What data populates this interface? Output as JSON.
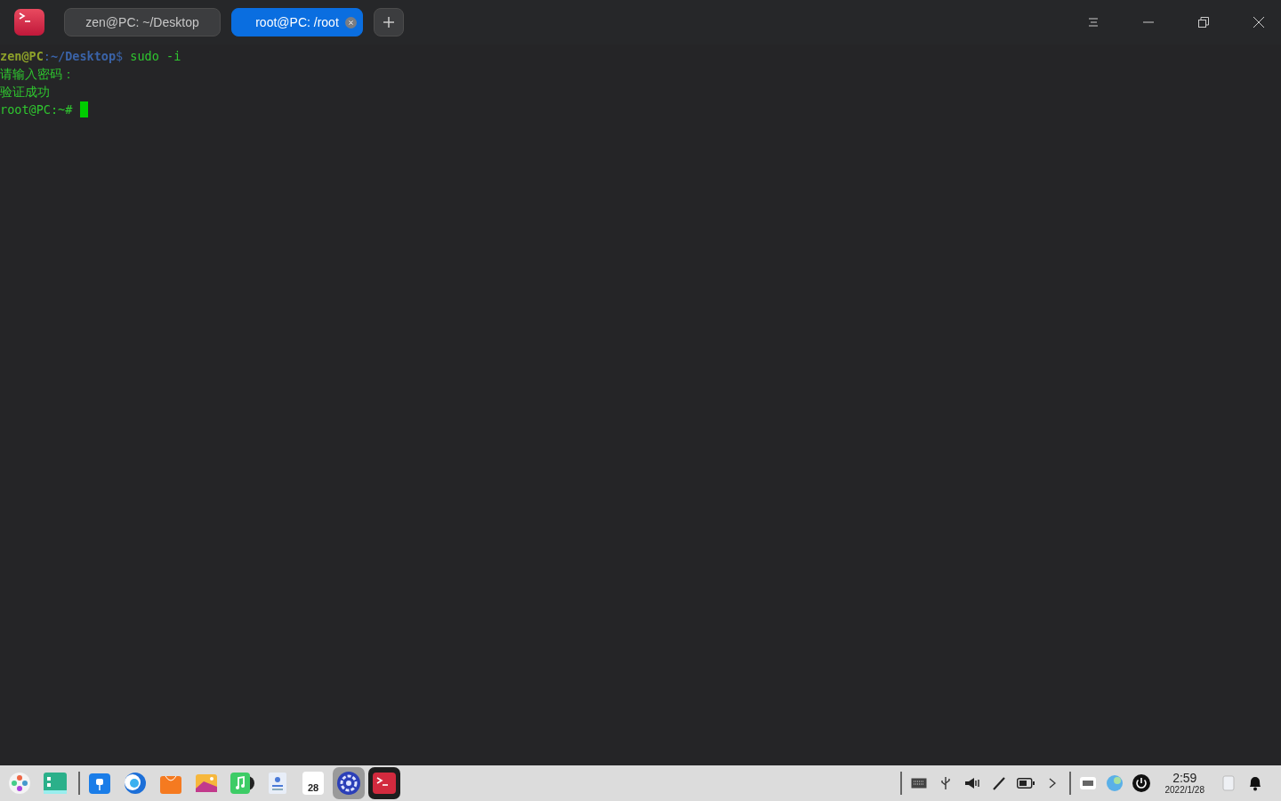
{
  "window": {
    "tabs": [
      {
        "label": "zen@PC: ~/Desktop",
        "selected": false
      },
      {
        "label": "root@PC: /root",
        "selected": true
      }
    ]
  },
  "terminal": {
    "lines": [
      {
        "kind": "prompt",
        "user": "zen@PC",
        "sep": ":",
        "path": "~/Desktop",
        "sign": "$",
        "command": "sudo -i"
      },
      {
        "kind": "output",
        "text": "请输入密码："
      },
      {
        "kind": "output",
        "text": "验证成功"
      },
      {
        "kind": "root",
        "text": "root@PC:~#"
      }
    ]
  },
  "dock": {
    "groups": [
      [
        {
          "kind": "launcher",
          "selected": false
        },
        {
          "kind": "desktop",
          "selected": false
        }
      ],
      [
        {
          "kind": "files",
          "selected": false
        },
        {
          "kind": "browser",
          "selected": false
        },
        {
          "kind": "store",
          "selected": false
        },
        {
          "kind": "photos",
          "selected": false
        },
        {
          "kind": "music",
          "selected": false
        },
        {
          "kind": "contacts",
          "selected": false
        },
        {
          "kind": "calendar",
          "selected": false,
          "text": "28"
        },
        {
          "kind": "settings",
          "selected": true
        },
        {
          "kind": "terminal",
          "selected": false
        }
      ]
    ]
  },
  "tray": {
    "time": "2:59",
    "date": "2022/1/28"
  }
}
